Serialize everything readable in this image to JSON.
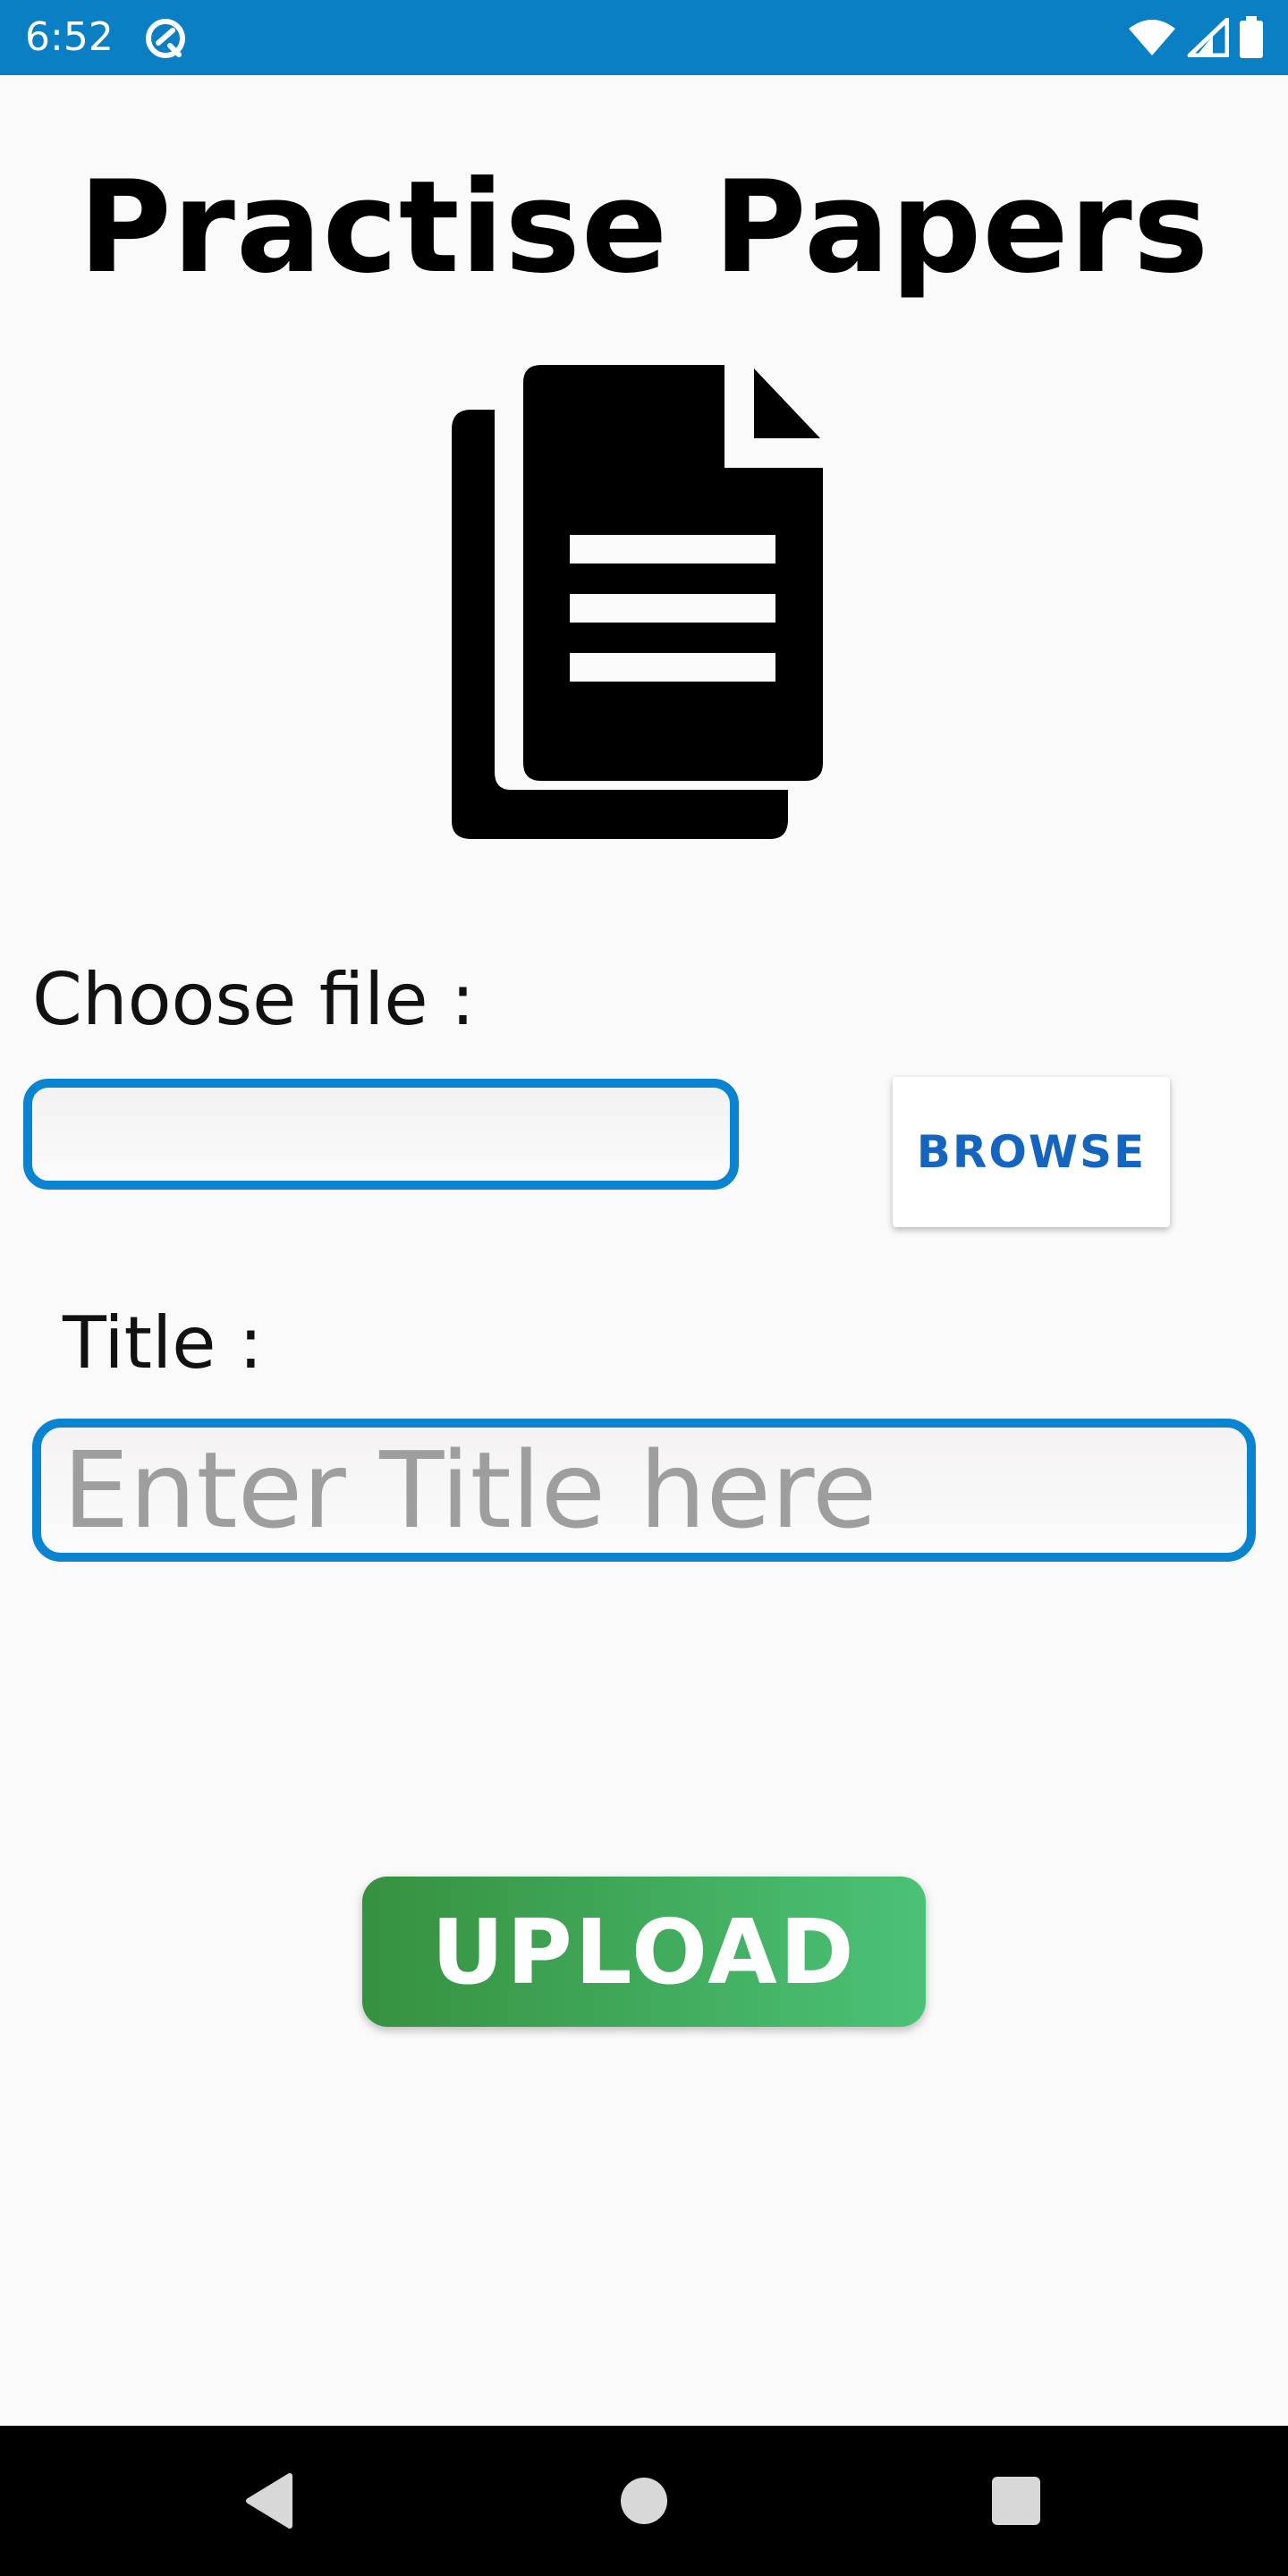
{
  "status_bar": {
    "time": "6:52",
    "app_icon": "circle-app-icon",
    "icons": [
      "wifi-icon",
      "signal-icon",
      "battery-icon"
    ],
    "background": "#0a7fc4"
  },
  "page": {
    "title": "Practise Papers",
    "icon": "documents-icon"
  },
  "form": {
    "file_label": "Choose file :",
    "file_value": "",
    "browse_label": "BROWSE",
    "title_label": "Title :",
    "title_value": "",
    "title_placeholder": "Enter Title here",
    "upload_label": "UPLOAD",
    "accent": "#0a84d0",
    "upload_colors": [
      "#36913f",
      "#4bc277"
    ]
  },
  "nav_bar": {
    "buttons": [
      "back-icon",
      "home-icon",
      "recents-icon"
    ]
  }
}
